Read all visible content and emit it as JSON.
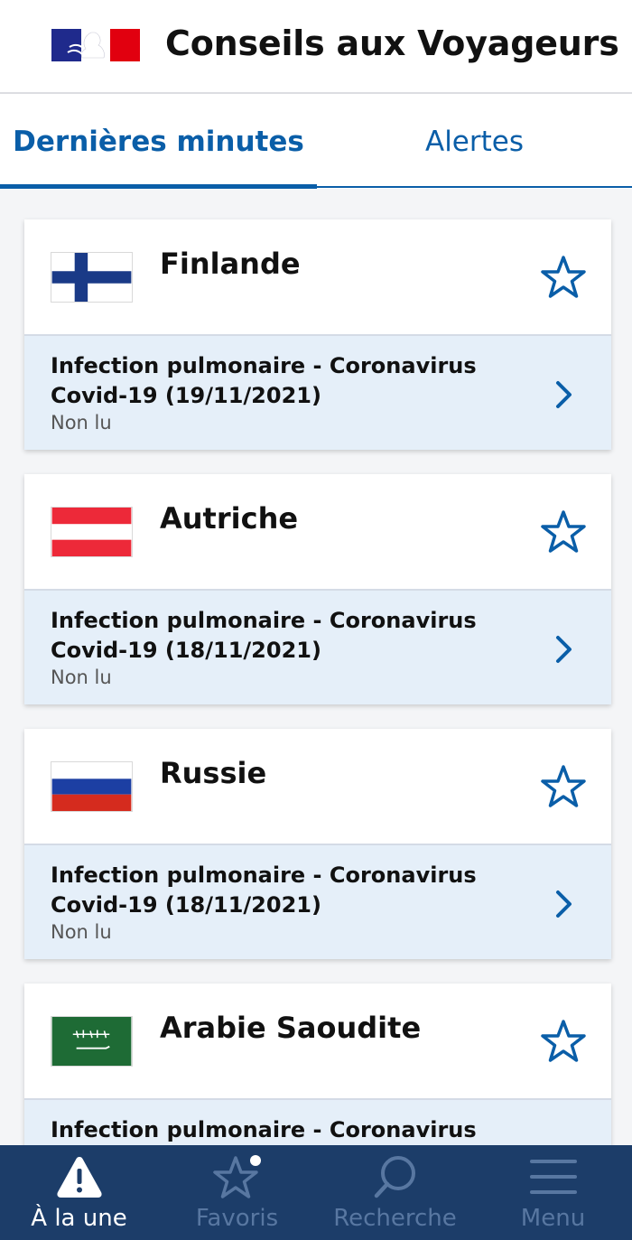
{
  "header": {
    "title": "Conseils aux Voyageurs",
    "logo_icon": "marianne-logo-icon"
  },
  "tabs": [
    {
      "label": "Dernières minutes",
      "active": true
    },
    {
      "label": "Alertes",
      "active": false
    }
  ],
  "cards": [
    {
      "country": "Finlande",
      "flag_icon": "finland-flag-icon",
      "alert": "Infection pulmonaire - Coronavirus Covid-19 (19/11/2021)",
      "status": "Non lu"
    },
    {
      "country": "Autriche",
      "flag_icon": "austria-flag-icon",
      "alert": "Infection pulmonaire - Coronavirus Covid-19 (18/11/2021)",
      "status": "Non lu"
    },
    {
      "country": "Russie",
      "flag_icon": "russia-flag-icon",
      "alert": "Infection pulmonaire - Coronavirus Covid-19 (18/11/2021)",
      "status": "Non lu"
    },
    {
      "country": "Arabie Saoudite",
      "flag_icon": "saudi-arabia-flag-icon",
      "alert": "Infection pulmonaire - Coronavirus",
      "status": ""
    }
  ],
  "bottom_nav": [
    {
      "label": "À la une",
      "icon": "alert-triangle-icon",
      "active": true
    },
    {
      "label": "Favoris",
      "icon": "star-icon",
      "active": false
    },
    {
      "label": "Recherche",
      "icon": "search-icon",
      "active": false
    },
    {
      "label": "Menu",
      "icon": "menu-icon",
      "active": false
    }
  ],
  "colors": {
    "primary_blue": "#0a5ea8",
    "nav_background": "#1c3d69",
    "card_body": "#e5eff9"
  }
}
